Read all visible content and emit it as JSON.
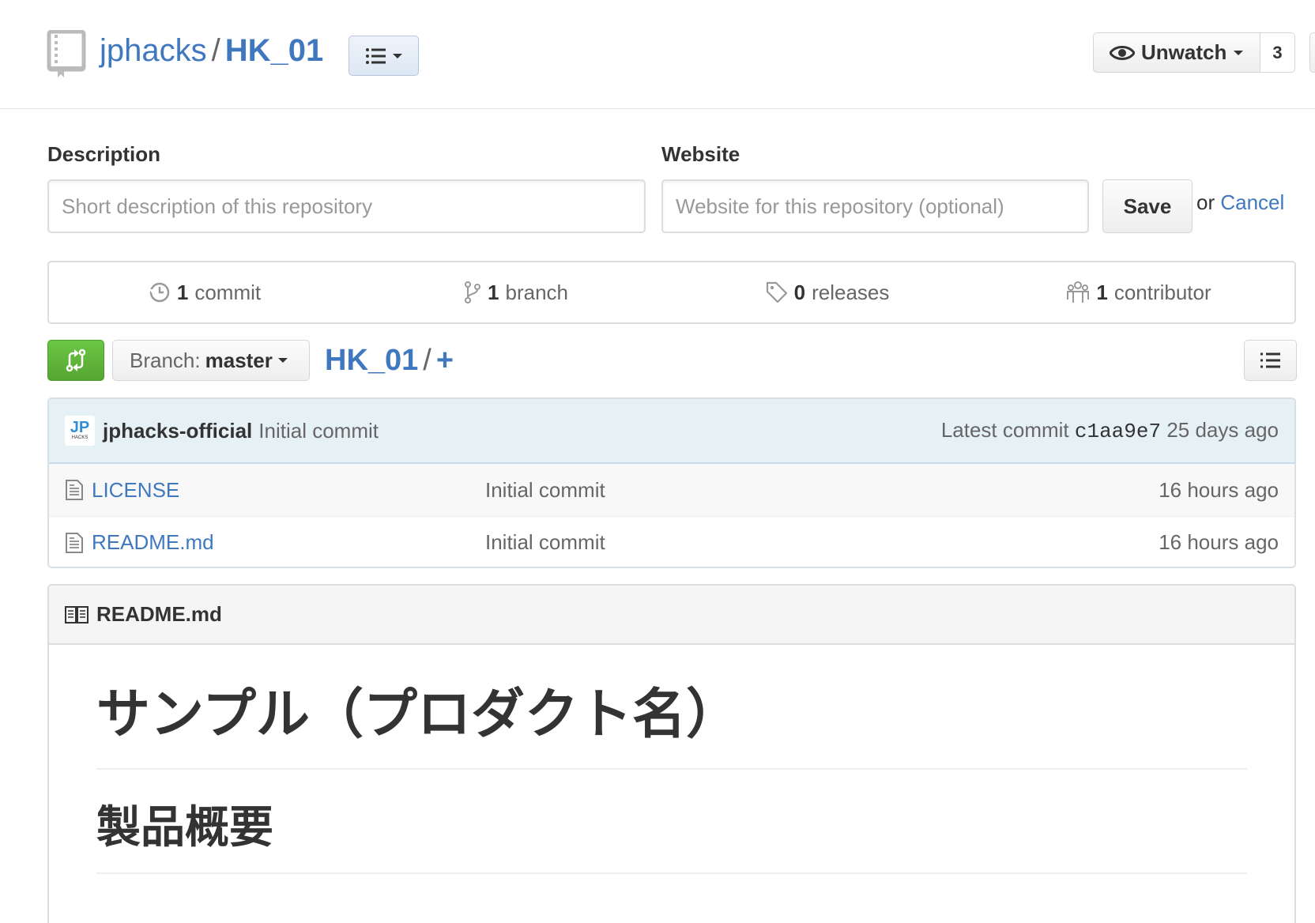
{
  "header": {
    "owner": "jphacks",
    "separator": "/",
    "repo": "HK_01",
    "watch_label": "Unwatch",
    "watch_count": "3"
  },
  "edit_form": {
    "description_label": "Description",
    "description_placeholder": "Short description of this repository",
    "website_label": "Website",
    "website_placeholder": "Website for this repository (optional)",
    "save_label": "Save",
    "or_text": "or",
    "cancel_label": "Cancel"
  },
  "summary": {
    "commits_num": "1",
    "commits_label": "commit",
    "branches_num": "1",
    "branches_label": "branch",
    "releases_num": "0",
    "releases_label": "releases",
    "contributors_num": "1",
    "contributors_label": "contributor"
  },
  "file_nav": {
    "branch_prefix": "Branch:",
    "branch_name": "master",
    "root": "HK_01",
    "slash": "/",
    "plus": "+"
  },
  "commit_tease": {
    "avatar_text_top": "JP",
    "avatar_text_bottom": "HACKS",
    "author": "jphacks-official",
    "message": "Initial commit",
    "latest_prefix": "Latest commit",
    "sha": "c1aa9e7",
    "age": "25 days ago"
  },
  "files": [
    {
      "name": "LICENSE",
      "message": "Initial commit",
      "age": "16 hours ago"
    },
    {
      "name": "README.md",
      "message": "Initial commit",
      "age": "16 hours ago"
    }
  ],
  "readme": {
    "filename": "README.md",
    "h1": "サンプル（プロダクト名）",
    "h2": "製品概要"
  },
  "colors": {
    "link": "#4078c0",
    "green": "#6cc644",
    "commit_bg": "#e6f1f6"
  }
}
